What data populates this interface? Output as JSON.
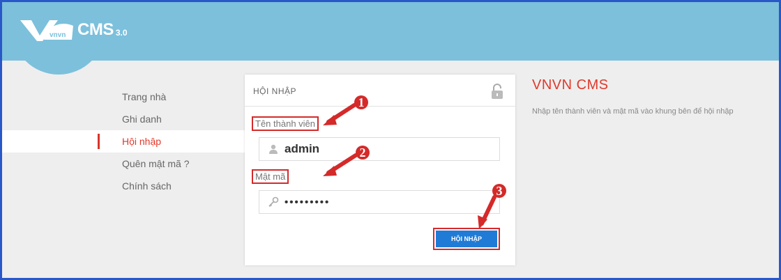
{
  "app": {
    "name": "CMS",
    "version": "3.0",
    "logo_text": "vnvn"
  },
  "sidebar": {
    "items": [
      {
        "label": "Trang nhà",
        "active": false
      },
      {
        "label": "Ghi danh",
        "active": false
      },
      {
        "label": "Hội nhập",
        "active": true
      },
      {
        "label": "Quên mật mã ?",
        "active": false
      },
      {
        "label": "Chính sách",
        "active": false
      }
    ]
  },
  "login": {
    "title": "HỘI NHẬP",
    "username_label": "Tên thành viên",
    "username_value": "admin",
    "password_label": "Mật mã",
    "password_value": "•••••••••",
    "submit_label": "HỘI NHẬP"
  },
  "info": {
    "title": "VNVN CMS",
    "text": "Nhập tên thành viên và mật mã vào khung bên để hội nhập"
  },
  "annotations": {
    "steps": [
      "1",
      "2",
      "3"
    ],
    "color": "#d42a2a"
  },
  "colors": {
    "header": "#7cc0dc",
    "accent": "#e0392b",
    "button": "#1f7bd6",
    "frame_border": "#2a57c8"
  }
}
